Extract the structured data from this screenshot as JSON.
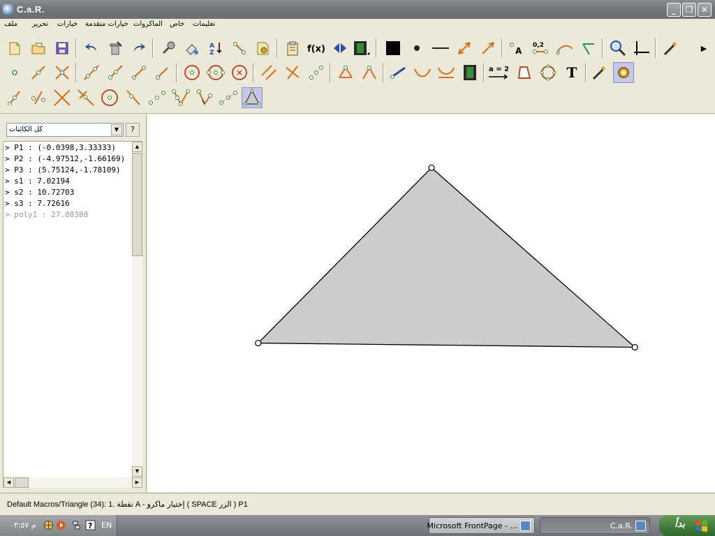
{
  "window": {
    "title": "C.a.R.",
    "min_glyph": "_",
    "max_glyph": "❐",
    "close_glyph": "✕"
  },
  "menu": {
    "items": [
      "ملف",
      "تحرير",
      "خيارات",
      "خيارات متقدمة",
      "الماكروات",
      "خاص",
      "تعليمات"
    ]
  },
  "toolbar": {
    "equals_label": "a = 2",
    "value_label": "0,2",
    "function_label": "f(x)",
    "text_label": "T",
    "point_label": "A",
    "more_glyph": "▶"
  },
  "objects": {
    "filter_value": "كل الكائنات",
    "help_label": "?",
    "rows": [
      "> P1 : (-0.0398,3.33333)",
      "> P2 : (-4.97512,-1.66169)",
      "> P3 : (5.75124,-1.78109)",
      "> s1 : 7.02194",
      "> s2 : 10.72703",
      "> s3 : 7.72616",
      "> poly1 : 27.08388"
    ]
  },
  "construction": {
    "vertices": [
      {
        "name": "P1",
        "x": -0.0398,
        "y": 3.33333
      },
      {
        "name": "P2",
        "x": -4.97512,
        "y": -1.66169
      },
      {
        "name": "P3",
        "x": 5.75124,
        "y": -1.78109
      }
    ],
    "fill_color": "#cccccc",
    "stroke_color": "#000000"
  },
  "status": {
    "text": "Default Macros/Triangle (34): 1. نقطة A - إختيار  ماكرو ( SPACE الزر ) P1"
  },
  "taskbar": {
    "clock": "م ٠٣:٥٧",
    "language": "EN",
    "tasks": [
      {
        "label": "Microsoft FrontPage - ..."
      },
      {
        "label": "C.a.R."
      }
    ],
    "start_label": "بدأ"
  }
}
